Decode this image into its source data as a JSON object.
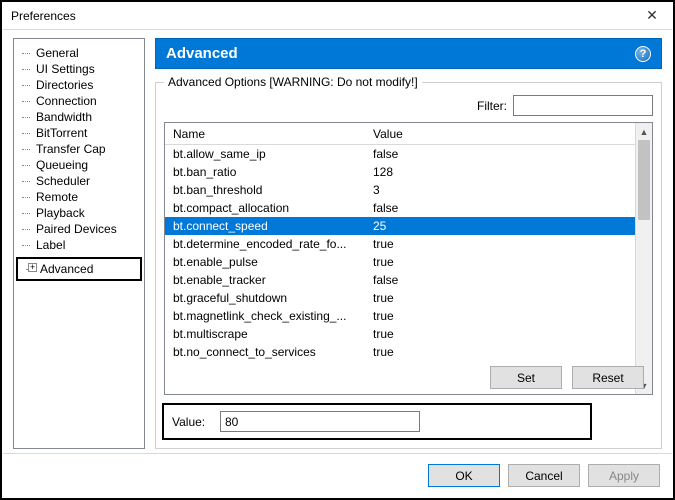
{
  "window": {
    "title": "Preferences",
    "close_glyph": "✕"
  },
  "tree": {
    "items": [
      {
        "label": "General"
      },
      {
        "label": "UI Settings"
      },
      {
        "label": "Directories"
      },
      {
        "label": "Connection"
      },
      {
        "label": "Bandwidth"
      },
      {
        "label": "BitTorrent"
      },
      {
        "label": "Transfer Cap"
      },
      {
        "label": "Queueing"
      },
      {
        "label": "Scheduler"
      },
      {
        "label": "Remote"
      },
      {
        "label": "Playback"
      },
      {
        "label": "Paired Devices"
      },
      {
        "label": "Label"
      }
    ],
    "selected": {
      "label": "Advanced",
      "expand_glyph": "+"
    }
  },
  "section": {
    "title": "Advanced",
    "help_glyph": "?"
  },
  "group": {
    "legend": "Advanced Options [WARNING: Do not modify!]",
    "filter_label": "Filter:",
    "filter_value": ""
  },
  "table": {
    "columns": {
      "name": "Name",
      "value": "Value"
    },
    "rows": [
      {
        "name": "bt.allow_same_ip",
        "value": "false"
      },
      {
        "name": "bt.ban_ratio",
        "value": "128"
      },
      {
        "name": "bt.ban_threshold",
        "value": "3"
      },
      {
        "name": "bt.compact_allocation",
        "value": "false"
      },
      {
        "name": "bt.connect_speed",
        "value": "25",
        "selected": true
      },
      {
        "name": "bt.determine_encoded_rate_fo...",
        "value": "true"
      },
      {
        "name": "bt.enable_pulse",
        "value": "true"
      },
      {
        "name": "bt.enable_tracker",
        "value": "false"
      },
      {
        "name": "bt.graceful_shutdown",
        "value": "true"
      },
      {
        "name": "bt.magnetlink_check_existing_...",
        "value": "true"
      },
      {
        "name": "bt.multiscrape",
        "value": "true"
      },
      {
        "name": "bt.no_connect_to_services",
        "value": "true"
      }
    ],
    "scroll": {
      "up": "▲",
      "down": "▼"
    }
  },
  "value_editor": {
    "label": "Value:",
    "value": "80",
    "set_label": "Set",
    "reset_label": "Reset"
  },
  "footer": {
    "ok": "OK",
    "cancel": "Cancel",
    "apply": "Apply"
  }
}
